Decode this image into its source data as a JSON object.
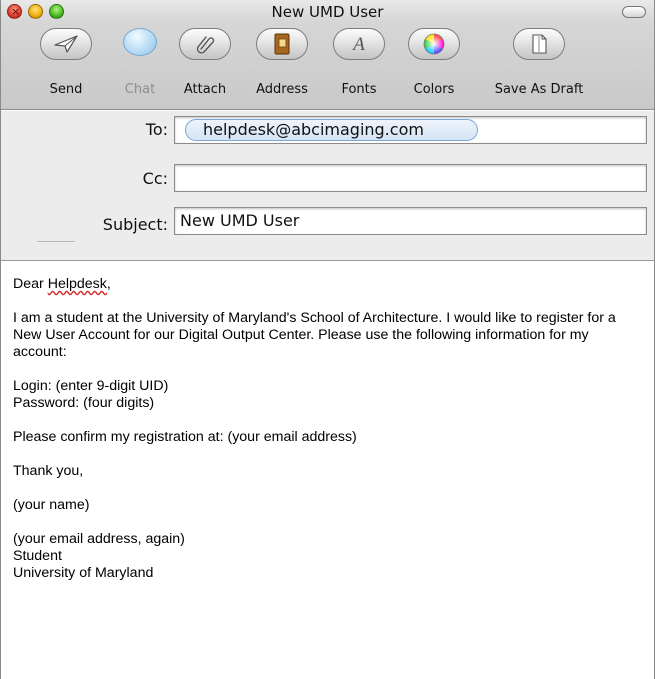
{
  "window": {
    "title": "New UMD User",
    "close_glyph": "×"
  },
  "toolbar": {
    "items": [
      {
        "label": "Send",
        "icon": "paper-plane-icon",
        "enabled": true
      },
      {
        "label": "Chat",
        "icon": "chat-bubble-icon",
        "enabled": false
      },
      {
        "label": "Attach",
        "icon": "paperclip-icon",
        "enabled": true
      },
      {
        "label": "Address",
        "icon": "address-book-icon",
        "enabled": true
      },
      {
        "label": "Fonts",
        "icon": "font-a-icon",
        "enabled": true
      },
      {
        "label": "Colors",
        "icon": "color-wheel-icon",
        "enabled": true
      },
      {
        "label": "Save As Draft",
        "icon": "draft-icon",
        "enabled": true
      }
    ]
  },
  "headers": {
    "to_label": "To:",
    "to_recipient": "helpdesk@abcimaging.com",
    "cc_label": "Cc:",
    "cc_value": "",
    "subject_label": "Subject:",
    "subject_value": "New UMD User"
  },
  "message": {
    "greeting_prefix": "Dear ",
    "greeting_name": "Helpdesk",
    "greeting_suffix": ",",
    "paragraph1": "I am a student at the University of Maryland's School of Architecture. I would like to register for a New User Account for our Digital Output Center. Please use the following information for my account:",
    "login_line": "Login: (enter 9-digit UID)",
    "password_line": "Password: (four digits)",
    "confirm_line": "Please confirm my registration at: (your email address)",
    "thanks_line": "Thank you,",
    "name_line": "(your name)",
    "sig_email": "(your email address, again)",
    "sig_role": "Student",
    "sig_school": "University of Maryland"
  },
  "colors": {
    "token_border": "#7ea5d3",
    "spellcheck": "#d12b2b"
  }
}
